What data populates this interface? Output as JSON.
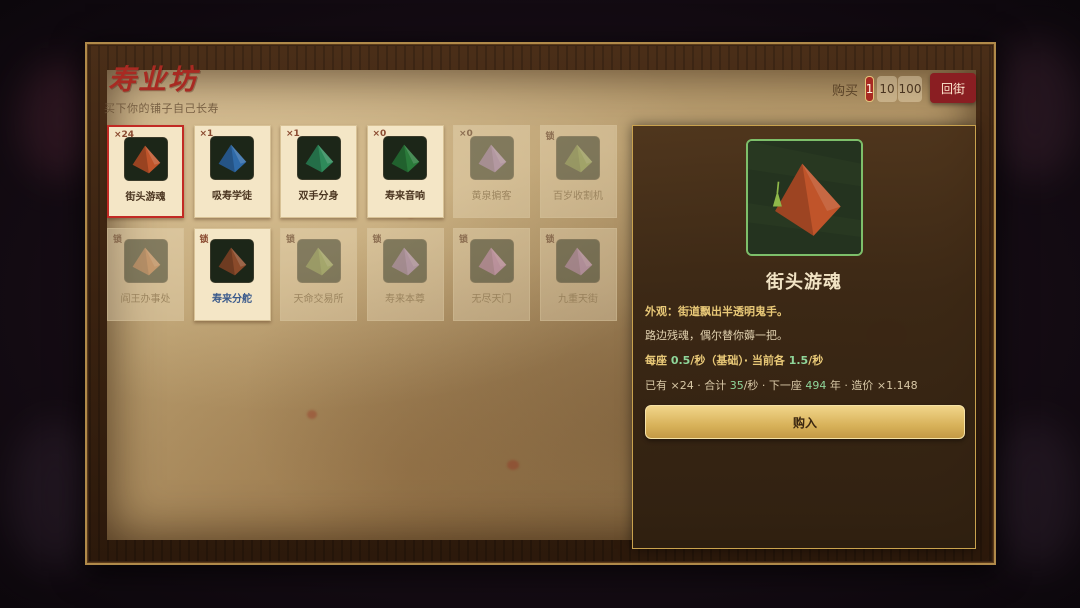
{
  "title": "寿业坊",
  "subtitle": "买下你的铺子自己长寿",
  "purchase": {
    "label": "购买",
    "options": [
      "1",
      "10",
      "100"
    ],
    "selected": "1"
  },
  "back_label": "回街",
  "cards": [
    {
      "badge": "×24",
      "name": "街头游魂",
      "locked": false,
      "selected": true,
      "color": "#c0542a"
    },
    {
      "badge": "×1",
      "name": "吸寿学徒",
      "locked": false,
      "selected": false,
      "color": "#2f6aa8"
    },
    {
      "badge": "×1",
      "name": "双手分身",
      "locked": false,
      "selected": false,
      "color": "#2e8a5a"
    },
    {
      "badge": "×0",
      "name": "寿来音响",
      "locked": false,
      "selected": false,
      "color": "#2a7a3a"
    },
    {
      "badge": "×0",
      "name": "黄泉掮客",
      "locked": true,
      "selected": false,
      "color": "#8a6ab0"
    },
    {
      "badge": "锁",
      "name": "百岁收割机",
      "locked": true,
      "selected": false,
      "color": "#6a8a3a"
    },
    {
      "badge": "锁",
      "name": "阎王办事处",
      "locked": true,
      "selected": false,
      "color": "#b06a3a"
    },
    {
      "badge": "锁",
      "name": "寿来分舵",
      "locked": false,
      "selected": false,
      "color": "#8a4a2a",
      "name_blue": true
    },
    {
      "badge": "锁",
      "name": "天命交易所",
      "locked": true,
      "selected": false,
      "color": "#6a8a3a"
    },
    {
      "badge": "锁",
      "name": "寿来本尊",
      "locked": true,
      "selected": false,
      "color": "#8a6ab0"
    },
    {
      "badge": "锁",
      "name": "无尽天门",
      "locked": true,
      "selected": false,
      "color": "#a86ab0"
    },
    {
      "badge": "锁",
      "name": "九重天街",
      "locked": true,
      "selected": false,
      "color": "#9a6ab0"
    }
  ],
  "detail": {
    "name": "街头游魂",
    "appearance": "外观：街道飘出半透明鬼手。",
    "flavor": "路边残魂，偶尔替你薅一把。",
    "rate_prefix": "每座 ",
    "rate_base": "0.5",
    "rate_mid": "/秒（基础）· 当前各 ",
    "rate_current": "1.5",
    "rate_suffix": "/秒",
    "stats_owned": "已有 ×24 · 合计 ",
    "stats_total": "35",
    "stats_mid": "/秒 · 下一座 ",
    "stats_next": "494",
    "stats_suffix": " 年 · 造价 ×1.148",
    "buy_label": "购入",
    "image_color": "#c0542a"
  }
}
